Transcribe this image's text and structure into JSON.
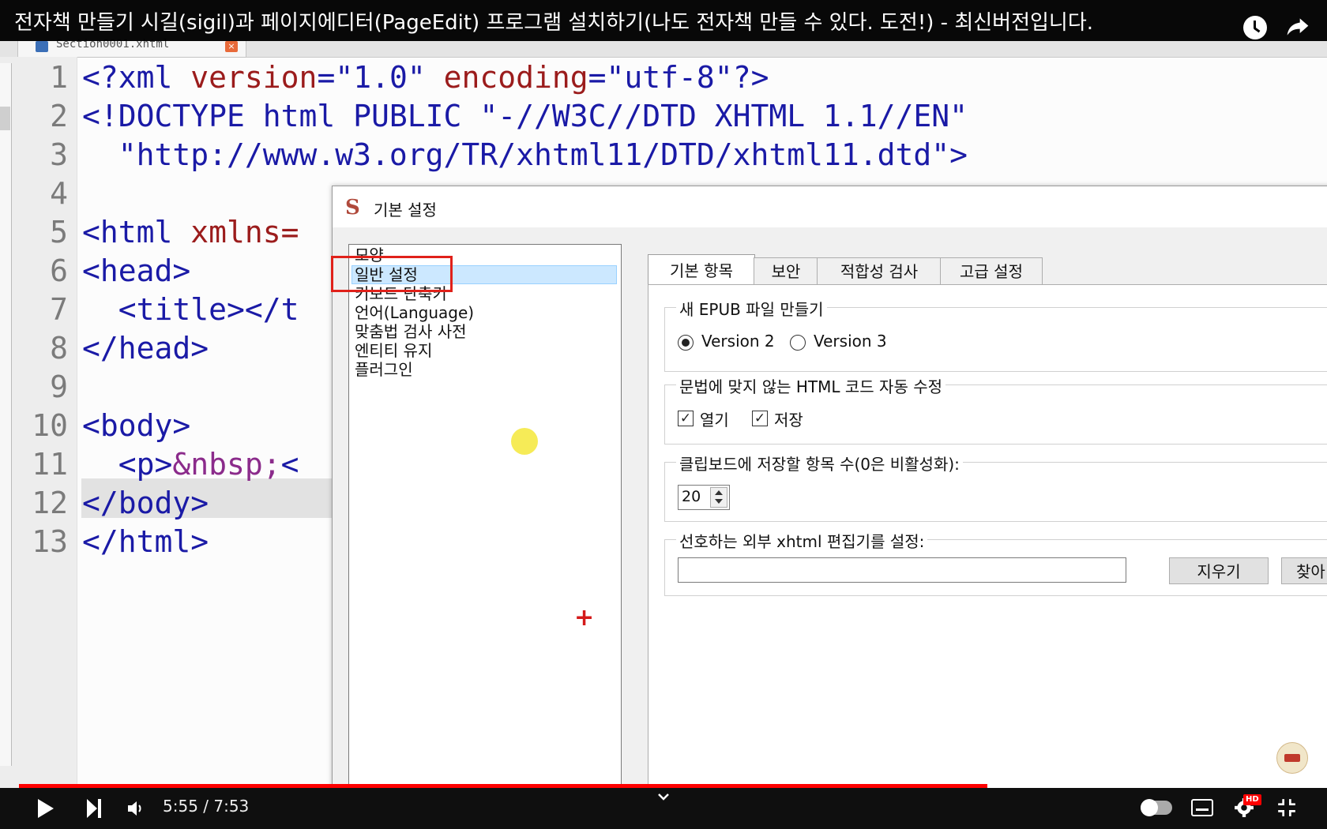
{
  "video": {
    "title": "전자책 만들기 시길(sigil)과 페이지에디터(PageEdit) 프로그램 설치하기(나도 전자책 만들 수 있다. 도전!) - 최신버전입니다.",
    "time_display": "5:55 / 7:53",
    "progress_fraction": 0.751,
    "buffer_fraction": 0.823,
    "hd_label": "HD"
  },
  "editor": {
    "file_tab": "Section0001.xhtml",
    "line_numbers": [
      "1",
      "2",
      "3",
      "4",
      "5",
      "6",
      "7",
      "8",
      "9",
      "10",
      "11",
      "12",
      "13"
    ],
    "lines": {
      "l1a": "<?xml ",
      "l1b": "version",
      "l1c": "=",
      "l1d": "\"1.0\"",
      "l1e": " ",
      "l1f": "encoding",
      "l1g": "=",
      "l1h": "\"utf-8\"",
      "l1i": "?>",
      "l2": "<!DOCTYPE html PUBLIC \"-//W3C//DTD XHTML 1.1//EN\"",
      "l3": "  \"http://www.w3.org/TR/xhtml11/DTD/xhtml11.dtd\">",
      "l5a": "<html ",
      "l5b": "xmlns=",
      "l6": "<head>",
      "l7": "  <title></t",
      "l8": "</head>",
      "l10": "<body>",
      "l11a": "  <p>",
      "l11b": "&nbsp;",
      "l11c": "<",
      "l12": "</body>",
      "l13": "</html>"
    }
  },
  "dialog": {
    "logo": "S",
    "title": "기본 설정",
    "categories": [
      "모양",
      "일반 설정",
      "키보드 단축키",
      "언어(Language)",
      "맞춤법 검사 사전",
      "엔티티 유지",
      "플러그인"
    ],
    "selected_category": "일반 설정",
    "tabs": [
      "기본 항목",
      "보안",
      "적합성 검사",
      "고급 설정"
    ],
    "active_tab": "기본 항목",
    "groups": {
      "epub": {
        "title": "새 EPUB 파일 만들기",
        "option_v2": "Version 2",
        "option_v3": "Version 3",
        "selected": "Version 2"
      },
      "autofix": {
        "title": "문법에 맞지 않는 HTML 코드 자동 수정",
        "open_label": "열기",
        "save_label": "저장",
        "open_checked": true,
        "save_checked": true
      },
      "clipboard": {
        "title": "클립보드에 저장할 항목 수(0은 비활성화):",
        "value": "20"
      },
      "external_editor": {
        "title": "선호하는 외부 xhtml 편집기를 설정:",
        "value": "",
        "clear_button": "지우기",
        "browse_button": "찾아"
      }
    }
  },
  "colors": {
    "progress": "#ff0000",
    "highlight_box": "#e0211a",
    "selection": "#cce8ff",
    "tag": "#1a1aa6",
    "attribute": "#9b1c1c"
  },
  "icons": {
    "clock": "watch-later-icon",
    "share": "share-icon",
    "play": "play-icon",
    "next": "next-icon",
    "volume": "volume-icon",
    "captions": "captions-icon",
    "settings": "settings-gear-icon",
    "fullscreen": "exit-fullscreen-icon"
  }
}
